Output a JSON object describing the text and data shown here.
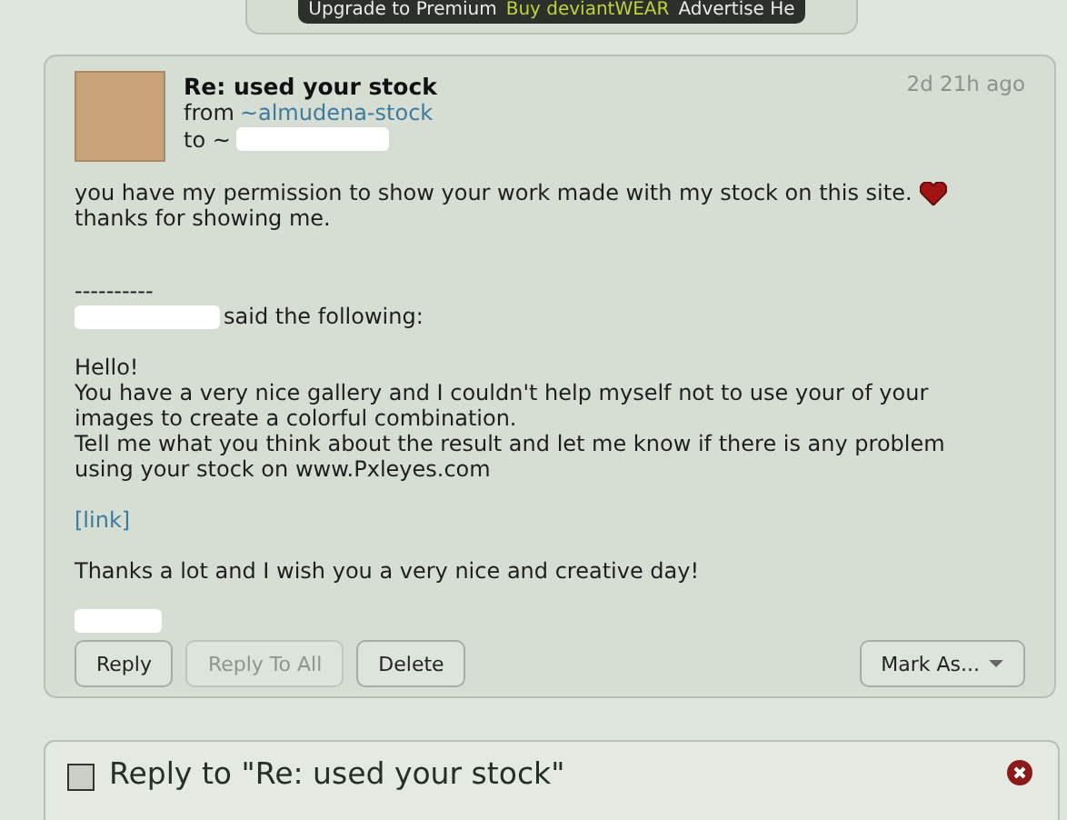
{
  "top_bar": {
    "links": [
      {
        "label": "Upgrade to Premium",
        "highlight": false
      },
      {
        "label": "Buy deviantWEAR",
        "highlight": true
      },
      {
        "label": "Advertise He",
        "highlight": false
      }
    ]
  },
  "message": {
    "subject": "Re: used your stock",
    "from_label": "from",
    "sender": "~almudena-stock",
    "to_label": "to ~",
    "time": "2d 21h ago",
    "blocks": [
      {
        "kind": "paragraph_with_heart",
        "lines": [
          "you have my permission to show your work made with my stock on this site.",
          "thanks for showing me."
        ]
      },
      {
        "kind": "quote_header",
        "rule": "----------",
        "text": "said the following:"
      },
      {
        "kind": "paragraph",
        "lines": [
          "Hello!",
          "You have a very nice gallery and I couldn't help myself not to use your of your",
          "images to create a colorful combination.",
          "Tell me what you think about the result and let me know if there is any problem",
          "using your stock on www.Pxleyes.com"
        ]
      },
      {
        "kind": "link",
        "text": "[link]"
      },
      {
        "kind": "paragraph",
        "lines": [
          "Thanks a lot and I wish you a very nice and creative day!"
        ]
      },
      {
        "kind": "redacted"
      }
    ],
    "buttons": [
      {
        "label": "Reply",
        "kind": "plain",
        "disabled": false
      },
      {
        "label": "Reply To All",
        "kind": "plain",
        "disabled": true
      },
      {
        "label": "Delete",
        "kind": "plain",
        "disabled": false
      },
      {
        "label": "Mark As...",
        "kind": "dropdown",
        "disabled": false
      }
    ]
  },
  "reply_panel": {
    "title": "Reply to \"Re: used your stock\""
  }
}
